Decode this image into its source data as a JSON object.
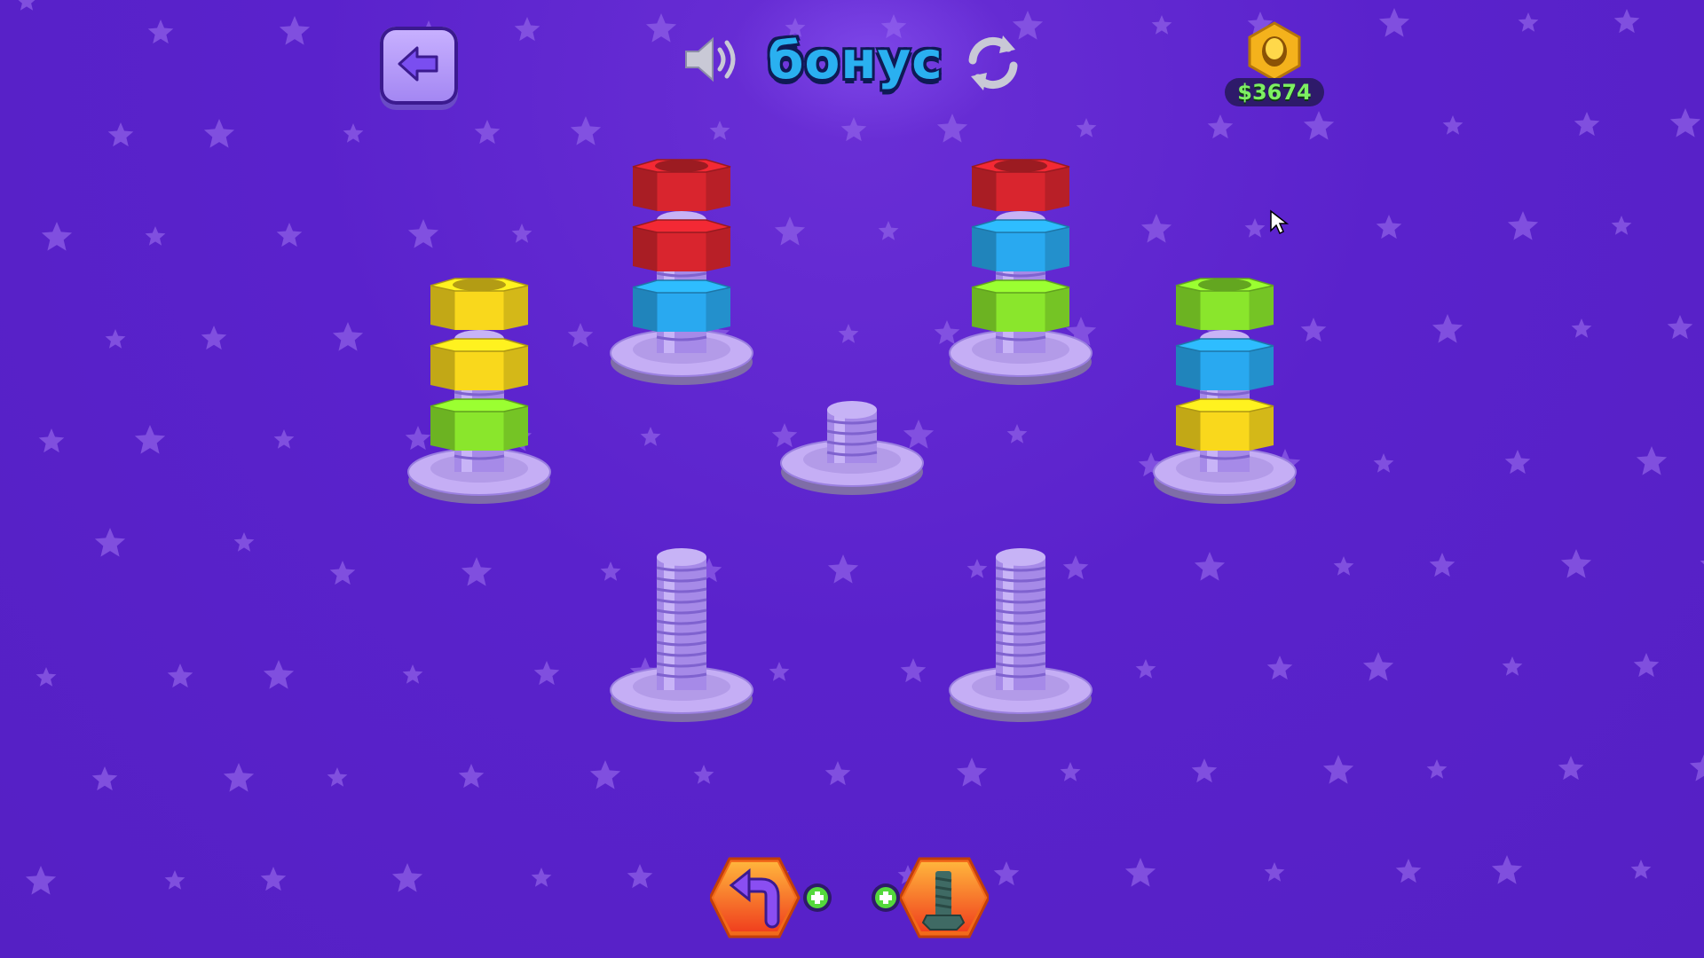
{
  "header": {
    "title": "бонус",
    "coins": "$3674"
  },
  "colors": {
    "red": "#d9252e",
    "blue": "#29a9f0",
    "green": "#8ae62c",
    "yellow": "#f9d81c",
    "bolt": "#b69bf0"
  },
  "bolts": [
    {
      "id": "bolt-1",
      "nuts": [
        "green",
        "yellow",
        "yellow"
      ]
    },
    {
      "id": "bolt-2",
      "nuts": [
        "blue",
        "red",
        "red"
      ]
    },
    {
      "id": "bolt-3",
      "nuts": []
    },
    {
      "id": "bolt-4",
      "nuts": [
        "green",
        "blue",
        "red"
      ]
    },
    {
      "id": "bolt-5",
      "nuts": [
        "yellow",
        "blue",
        "green"
      ]
    },
    {
      "id": "bolt-6",
      "nuts": []
    },
    {
      "id": "bolt-7",
      "nuts": []
    }
  ],
  "icons": {
    "back": "arrow-left-icon",
    "sound": "speaker-icon",
    "restart": "restart-icon",
    "coin": "gold-nut-icon",
    "undo": "undo-arrow-icon",
    "add_bolt": "bolt-icon",
    "plus": "plus-icon"
  }
}
